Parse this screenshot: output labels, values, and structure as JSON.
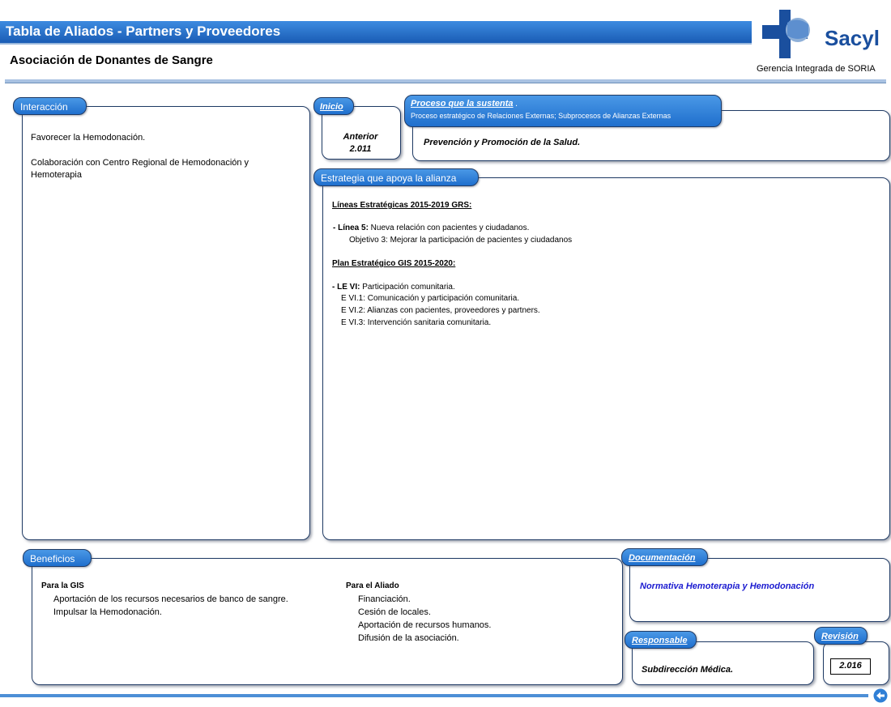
{
  "header": {
    "title": "Tabla de Aliados - Partners y Proveedores",
    "subtitle": "Asociación de Donantes de Sangre",
    "logo_text": "Sacyl",
    "gerencia": "Gerencia Integrada de SORIA"
  },
  "interaccion": {
    "label": "Interacción",
    "items": [
      "Favorecer la Hemodonación.",
      "Colaboración con Centro Regional de Hemodonación y",
      "Hemoterapia"
    ]
  },
  "inicio": {
    "label": "Inicio",
    "value_line1": "Anterior",
    "value_line2": "2.011"
  },
  "proceso": {
    "label": "Proceso que la sustenta",
    "label_suffix": ".",
    "subtitle": "Proceso estratégico de Relaciones Externas; Subprocesos de Alianzas Externas",
    "value": "Prevención y Promoción de la Salud."
  },
  "estrategia": {
    "label": "Estrategia que apoya la alianza",
    "lineas_heading": "Líneas Estratégicas 2015-2019  GRS:",
    "linea5_bold": "- Línea 5:",
    "linea5_text": " Nueva relación con pacientes y ciudadanos.",
    "objetivo": "Objetivo 3:  Mejorar la participación de pacientes y ciudadanos",
    "plan_heading": "Plan Estratégico GIS 2015-2020:",
    "levi_bold": "- LE VI:",
    "levi_text": " Participación comunitaria.",
    "items": [
      "E VI.1: Comunicación y participación comunitaria.",
      "E VI.2: Alianzas con pacientes, proveedores y partners.",
      "E VI.3: Intervención sanitaria comunitaria."
    ]
  },
  "beneficios": {
    "label": "Beneficios",
    "gis_heading": "Para la GIS",
    "gis_items": [
      "Aportación de los recursos necesarios de banco de sangre.",
      "Impulsar la Hemodonación."
    ],
    "aliado_heading": "Para el Aliado",
    "aliado_items": [
      "Financiación.",
      "Cesión de locales.",
      "Aportación de recursos humanos.",
      "Difusión de la asociación."
    ]
  },
  "documentacion": {
    "label": "Documentación",
    "value": "Normativa Hemoterapia y Hemodonación"
  },
  "responsable": {
    "label": "Responsable",
    "value": "Subdirección Médica."
  },
  "revision": {
    "label": "Revisión",
    "value": "2.016"
  },
  "colors": {
    "title_bar": "#1d5fb3",
    "pill": "#2f80da",
    "border": "#1f3a64",
    "link_blue": "#1a1ad0",
    "logo_blue": "#1a4f9e"
  },
  "icons": {
    "back": "back-arrow-icon"
  }
}
